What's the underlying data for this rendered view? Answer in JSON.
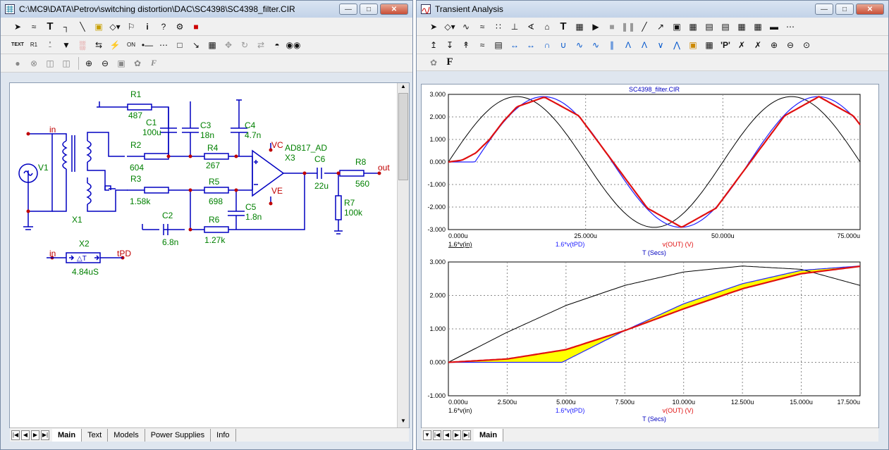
{
  "schematic_window": {
    "title": "C:\\MC9\\DATA\\Petrov\\switching distortion\\DAC\\SC4398\\SC4398_filter.CIR",
    "tabs": [
      "Main",
      "Text",
      "Models",
      "Power Supplies",
      "Info"
    ],
    "labels": {
      "R1": "R1",
      "R1v": "487",
      "C1": "C1",
      "C1v": "100u",
      "C3": "C3",
      "C3v": "18n",
      "C4": "C4",
      "C4v": "4.7n",
      "R2": "R2",
      "R2v": "604",
      "R4": "R4",
      "R4v": "267",
      "R3": "R3",
      "R3v": "1.58k",
      "R5": "R5",
      "R5v": "698",
      "C5": "C5",
      "C5v": "1.8n",
      "C2": "C2",
      "C2v": "6.8n",
      "R6": "R6",
      "R6v": "1.27k",
      "V1": "V1",
      "X1": "X1",
      "X3": "X3",
      "X3model": "AD817_AD",
      "C6": "C6",
      "C6v": "22u",
      "R8": "R8",
      "R8v": "560",
      "R7": "R7",
      "R7v": "100k",
      "X2": "X2",
      "X2v": "4.84uS",
      "in1": "in",
      "in2": "in",
      "out": "out",
      "tPD": "tPD",
      "VC": "VC",
      "VE": "VE",
      "delay": "△T"
    }
  },
  "analysis_window": {
    "title": "Transient Analysis",
    "tabs": [
      "Main"
    ],
    "plot1": {
      "title": "SC4398_filter.CIR",
      "yticks": [
        "3.000",
        "2.000",
        "1.000",
        "0.000",
        "-1.000",
        "-2.000",
        "-3.000"
      ],
      "xticks": [
        "0.000u",
        "25.000u",
        "50.000u",
        "75.000u"
      ],
      "legend": [
        "1.6*v(in)",
        "1.6*v(tPD)",
        "v(OUT) (V)"
      ],
      "xlabel": "T (Secs)"
    },
    "plot2": {
      "yticks": [
        "3.000",
        "2.000",
        "1.000",
        "0.000",
        "-1.000"
      ],
      "xticks": [
        "0.000u",
        "2.500u",
        "5.000u",
        "7.500u",
        "10.000u",
        "12.500u",
        "15.000u",
        "17.500u"
      ],
      "legend": [
        "1.6*v(in)",
        "1.6*v(tPD)",
        "v(OUT) (V)"
      ],
      "xlabel": "T (Secs)"
    }
  },
  "colors": {
    "v_in": "#000000",
    "v_tPD": "#2020ff",
    "v_out": "#e01010",
    "fill": "#ffff00",
    "schematic_wire": "#0000c0",
    "schematic_text": "#008000",
    "node": "#c00000"
  },
  "chart_data": [
    {
      "type": "line",
      "title": "SC4398_filter.CIR",
      "xlabel": "T (Secs)",
      "ylabel": "",
      "xlim": [
        0,
        75
      ],
      "ylim": [
        -3,
        3
      ],
      "x_unit": "u",
      "series": [
        {
          "name": "1.6*v(in)",
          "x": [
            0,
            6.25,
            12.5,
            18.75,
            25,
            31.25,
            37.5,
            43.75,
            50,
            56.25,
            62.5,
            68.75,
            75
          ],
          "y": [
            0,
            2.05,
            2.9,
            2.05,
            0,
            -2.05,
            -2.9,
            -2.05,
            0,
            2.05,
            2.9,
            2.05,
            0
          ]
        },
        {
          "name": "1.6*v(tPD)",
          "x": [
            0,
            4.84,
            6.25,
            10,
            17.34,
            23.59,
            29.84,
            36.09,
            42.34,
            48.59,
            54.84,
            61.09,
            67.34,
            73.59,
            75
          ],
          "y": [
            0,
            0,
            0.7,
            2.0,
            2.9,
            2.05,
            0,
            -2.05,
            -2.9,
            -2.05,
            0,
            2.05,
            2.9,
            2.05,
            1.7
          ]
        },
        {
          "name": "v(OUT) (V)",
          "x": [
            0,
            2.5,
            5,
            7.5,
            10,
            12.5,
            17.5,
            23.75,
            30,
            36.25,
            42.5,
            48.75,
            55,
            61.25,
            67.5,
            73.75,
            75
          ],
          "y": [
            0,
            0.08,
            0.4,
            1.0,
            1.8,
            2.45,
            2.88,
            2.05,
            0,
            -2.05,
            -2.9,
            -2.05,
            0,
            2.05,
            2.9,
            2.05,
            1.65
          ]
        }
      ]
    },
    {
      "type": "line",
      "title": "",
      "xlabel": "T (Secs)",
      "ylabel": "",
      "xlim": [
        0,
        17.5
      ],
      "ylim": [
        -1,
        3
      ],
      "x_unit": "u",
      "series": [
        {
          "name": "1.6*v(in)",
          "x": [
            0,
            2.5,
            5,
            7.5,
            10,
            12.5,
            15,
            17.5
          ],
          "y": [
            0,
            0.9,
            1.7,
            2.3,
            2.7,
            2.88,
            2.78,
            2.3
          ]
        },
        {
          "name": "1.6*v(tPD)",
          "x": [
            0,
            4.84,
            5,
            7.5,
            10,
            12.5,
            15,
            17.5
          ],
          "y": [
            0,
            0,
            0.06,
            0.95,
            1.75,
            2.35,
            2.75,
            2.88
          ]
        },
        {
          "name": "v(OUT) (V)",
          "x": [
            0,
            2.5,
            5,
            7.5,
            10,
            12.5,
            15,
            17.5
          ],
          "y": [
            0,
            0.1,
            0.38,
            0.95,
            1.6,
            2.2,
            2.65,
            2.87
          ]
        }
      ]
    }
  ]
}
